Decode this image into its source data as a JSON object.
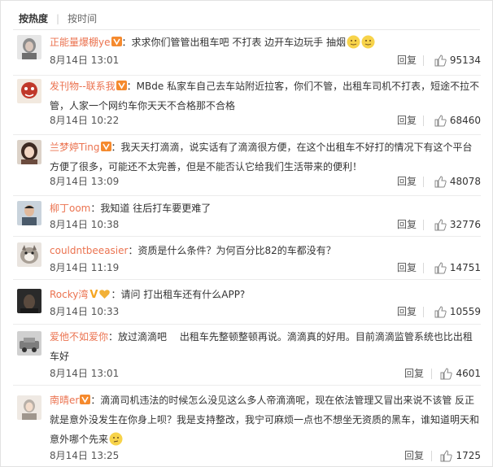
{
  "sort": {
    "by_hot": "按热度",
    "by_time": "按时间"
  },
  "reply_label": "回复",
  "comments": [
    {
      "user": "正能量爆棚ye",
      "vip": true,
      "text": "：求求你们管管出租车吧 不打表 边开车边玩手 抽烟",
      "emoji": [
        "emoji-face-1",
        "emoji-face-2"
      ],
      "time": "8月14日 13:01",
      "likes": "95134",
      "avatar_color": "#8d8d8d"
    },
    {
      "user": "发刊物--联系我",
      "vip": true,
      "text": "：MBde 私家车自己去车站附近拉客，你们不管，出租车司机不打表，短途不拉不管，人家一个网约车你天天不合格那不合格",
      "emoji": [],
      "time": "8月14日 10:22",
      "likes": "68460",
      "avatar_color": "#c0392b"
    },
    {
      "user": "兰梦婷Ting",
      "vip": true,
      "text": "：我天天打滴滴，说实话有了滴滴很方便，在这个出租车不好打的情况下有这个平台方便了很多，可能还不太完善，但是不能否认它给我们生活带来的便利！",
      "emoji": [],
      "time": "8月14日 13:09",
      "likes": "48078",
      "avatar_color": "#6b4b3e"
    },
    {
      "user": "柳丁oom",
      "vip": false,
      "text": "：我知道 往后打车要更难了",
      "emoji": [],
      "time": "8月14日 10:38",
      "likes": "32776",
      "avatar_color": "#4a5a6a"
    },
    {
      "user": "couldntbeeasier",
      "vip": false,
      "text": "：资质是什么条件？为何百分比82的车都没有？",
      "emoji": [],
      "time": "8月14日 11:19",
      "likes": "14751",
      "avatar_color": "#a89f95"
    },
    {
      "user": "Rocky湾",
      "vip": false,
      "vbadge": "V",
      "text": "：请问 打出租车还有什么APP?",
      "emoji": [],
      "time": "8月14日 10:33",
      "likes": "10559",
      "avatar_color": "#3a3a3a"
    },
    {
      "user": "爱他不如爱你",
      "vip": false,
      "text": "：放过滴滴吧　 出租车先整顿整顿再说。滴滴真的好用。目前滴滴监管系统也比出租车好",
      "emoji": [],
      "time": "8月14日 13:01",
      "likes": "4601",
      "avatar_color": "#7d7d7d"
    },
    {
      "user": "南晴er",
      "vip": true,
      "text": "：滴滴司机违法的时候怎么没见这么多人帝滴滴呢，现在依法管理又冒出来说不该管 反正就是意外没发生在你身上呗？我是支持整改，我宁可麻烦一点也不想坐无资质的黑车，谁知道明天和意外哪个先来",
      "emoji": [
        "emoji-think",
        "emoji-face-end"
      ],
      "time": "8月14日 13:25",
      "likes": "1725",
      "avatar_color": "#b8b0a8"
    }
  ]
}
